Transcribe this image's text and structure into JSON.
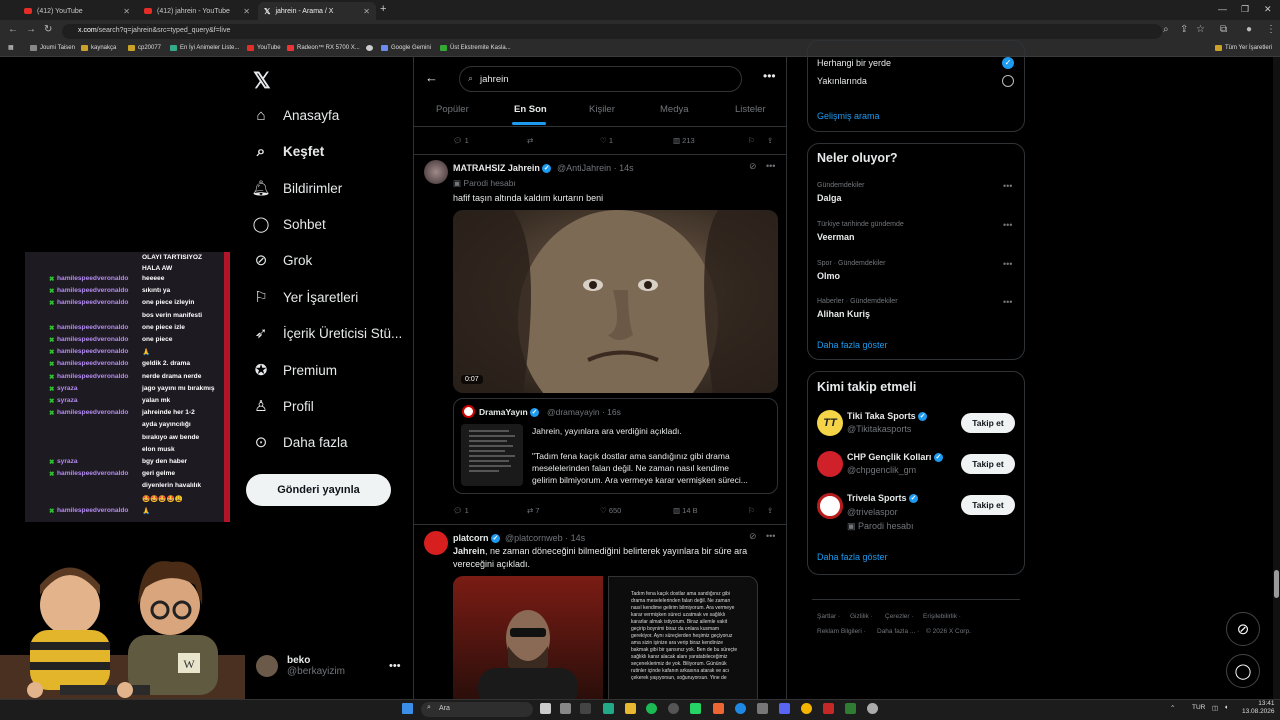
{
  "browser": {
    "tabs": [
      {
        "label": "(412) YouTube",
        "icon": "youtube-icon"
      },
      {
        "label": "(412) jahrein - YouTube",
        "icon": "youtube-icon"
      },
      {
        "label": "jahrein - Arama / X",
        "icon": "x-logo-icon"
      }
    ],
    "url_host": "x.com",
    "url_path": "/search?q=jahrein&src=typed_query&f=live",
    "bookmarks": [
      "Joumi Taisen",
      "kaynakça",
      "cp20077",
      "En İyi Animeler Liste...",
      "YouTube",
      "Radeon™ RX 5700 X...",
      "Google Gemini",
      "Üst Ekstremite Kasla..."
    ],
    "all_bookmarks": "Tüm Yer İşaretleri"
  },
  "sidebar": {
    "items": [
      {
        "label": "Anasayfa",
        "icon": "home-icon"
      },
      {
        "label": "Keşfet",
        "icon": "search-icon"
      },
      {
        "label": "Bildirimler",
        "icon": "bell-icon"
      },
      {
        "label": "Sohbet",
        "icon": "chat-icon"
      },
      {
        "label": "Grok",
        "icon": "grok-icon"
      },
      {
        "label": "Yer İşaretleri",
        "icon": "bookmark-icon"
      },
      {
        "label": "İçerik Üreticisi Stü...",
        "icon": "rocket-icon"
      },
      {
        "label": "Premium",
        "icon": "premium-icon"
      },
      {
        "label": "Profil",
        "icon": "person-icon"
      },
      {
        "label": "Daha fazla",
        "icon": "more-circle-icon"
      }
    ],
    "post_button": "Gönderi yayınla",
    "account": {
      "name": "beko",
      "handle": "@berkayizim"
    }
  },
  "stream_chat": {
    "header": [
      "OLAYI TARTISIYOZ",
      "HALA AW"
    ],
    "lines": [
      {
        "user": "hamilespeedveronaldo",
        "msg": "heeeee"
      },
      {
        "user": "hamilespeedveronaldo",
        "msg": "sıkıntı ya"
      },
      {
        "user": "hamilespeedveronaldo",
        "msg": "one piece izleyin"
      },
      {
        "user": "",
        "msg": "bos verin manifesti"
      },
      {
        "user": "hamilespeedveronaldo",
        "msg": "one piece izle"
      },
      {
        "user": "hamilespeedveronaldo",
        "msg": "one piece"
      },
      {
        "user": "hamilespeedveronaldo",
        "msg": "🙏"
      },
      {
        "user": "hamilespeedveronaldo",
        "msg": "geldik 2. drama"
      },
      {
        "user": "hamilespeedveronaldo",
        "msg": "nerde drama nerde"
      },
      {
        "user": "syraza",
        "msg": "jago yayını mı bırakmış"
      },
      {
        "user": "syraza",
        "msg": "yalan mk"
      },
      {
        "user": "hamilespeedveronaldo",
        "msg": "jahreinde her 1-2"
      },
      {
        "user": "",
        "msg": "ayda yayıncılığı"
      },
      {
        "user": "",
        "msg": "bırakıyo aw bende"
      },
      {
        "user": "",
        "msg": "elon musk"
      },
      {
        "user": "syraza",
        "msg": "bgy den haber"
      },
      {
        "user": "hamilespeedveronaldo",
        "msg": "geri gelme"
      },
      {
        "user": "",
        "msg": "diyenlerin havalılık"
      },
      {
        "user": "",
        "msg": "🤩🤩🤩🤩😩"
      },
      {
        "user": "hamilespeedveronaldo",
        "msg": "🙏"
      }
    ]
  },
  "search": {
    "query": "jahrein",
    "tabs": [
      "Popüler",
      "En Son",
      "Kişiler",
      "Medya",
      "Listeler"
    ],
    "active_tab": "En Son"
  },
  "prev_actions": {
    "replies": "1",
    "reposts": "",
    "likes": "1",
    "views": "213"
  },
  "tweet1": {
    "name": "MATRAHSIZ Jahrein",
    "handle": "@AntiJahrein",
    "time": "14s",
    "label": "Parodi hesabı",
    "text": "hafif taşın altında kaldım kurtarın beni",
    "video_time": "0:07",
    "quote": {
      "name": "DramaYayın",
      "handle": "@dramayayin",
      "time": "16s",
      "line1": "Jahrein, yayınlara ara verdiğini açıkladı.",
      "line2": "\"Tadım fena kaçık dostlar ama sandığınız gibi drama",
      "line3": "meselelerinden falan değil. Ne zaman nasıl kendime",
      "line4": "gelirim bilmiyorum. Ara vermeye karar vermişken süreci..."
    },
    "actions": {
      "replies": "1",
      "reposts": "7",
      "likes": "650",
      "views": "14 B"
    }
  },
  "tweet2": {
    "name": "platcorn",
    "handle": "@platcornweb",
    "time": "14s",
    "text_bold": "Jahrein",
    "text_rest": ", ne zaman döneceğini bilmediğini belirterek yayınlara bir süre ara",
    "text_line2": "vereceğini açıkladı.",
    "img2_text": "Tadım fena kaçık dostlar ama sandığınız gibi drama meselelerinden falan değil. Ne zaman nasıl kendime gelirim bilmiyorum. Ara vermeye karar vermişken süreci uzatmak ve sağlıklı kararlar almak istiyorum. Biraz ailemle vakit geçirip boynimi biraz da onlara kusmam gerekiyor. Aynı süreçlerden heşimiz geçiyoruz ama sizin işinize ara verip biraz kendinize bakmak gibi bir şansınız yok. Ben de bu süreçte sağlıklı karar alacak alanı yaratabileceğimiz seçeneklerimiz de yok. Biliyorum. Gününük rutinler içinde kafanın arkasına atarak ve acı çekerek yaşıyorsun, soğuruyorsun. Yine de"
  },
  "right": {
    "location_options": [
      {
        "label": "Herhangi bir yerde",
        "selected": true
      },
      {
        "label": "Yakınlarında",
        "selected": false
      }
    ],
    "advanced_search": "Gelişmiş arama",
    "trends_title": "Neler oluyor?",
    "trends": [
      {
        "context": "Gündemdekiler",
        "name": "Dalga"
      },
      {
        "context": "Türkiye tarihinde gündemde",
        "name": "Veerman"
      },
      {
        "context": "Spor · Gündemdekiler",
        "name": "Olmo"
      },
      {
        "context": "Haberler · Gündemdekiler",
        "name": "Alihan Kuriş"
      }
    ],
    "show_more": "Daha fazla göster",
    "follow_title": "Kimi takip etmeli",
    "follow": [
      {
        "name": "Tiki Taka Sports",
        "handle": "@Tikitakasports",
        "note": "",
        "color": "#f5d547"
      },
      {
        "name": "CHP Gençlik Kolları",
        "handle": "@chpgenclik_gm",
        "note": "",
        "color": "#d0202a"
      },
      {
        "name": "Trivela Sports",
        "handle": "@trivelaspor",
        "note": "Parodi hesabı",
        "color": "#ffffff"
      }
    ],
    "follow_button": "Takip et",
    "footer_line1": [
      "Şartlar",
      "Gizlilik",
      "Çerezler",
      "Erişilebilirlik"
    ],
    "footer_line2": [
      "Reklam Bilgileri",
      "Daha fazla ...",
      "© 2026 X Corp."
    ]
  },
  "taskbar": {
    "search": "Ara",
    "lang": "TUR",
    "time": "13:41",
    "date": "13.08.2026"
  },
  "colors": {
    "accent": "#1d9bf0",
    "background": "#000000",
    "border": "#2f3336"
  }
}
